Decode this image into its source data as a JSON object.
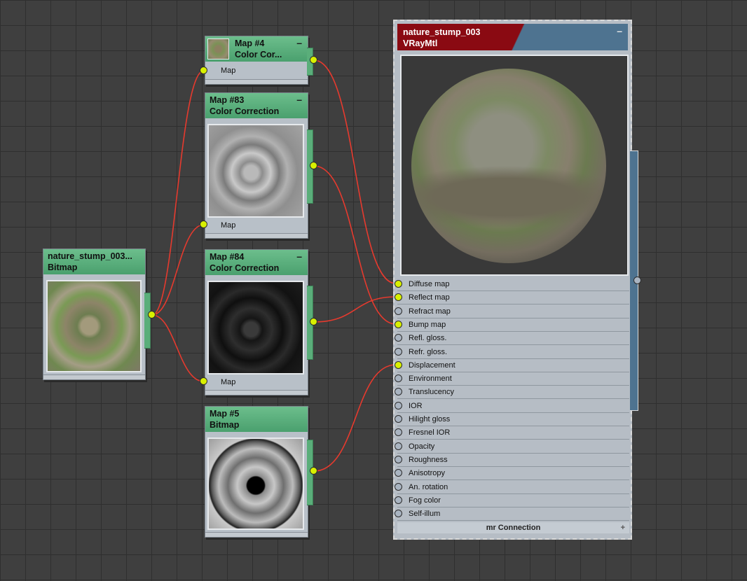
{
  "nodes": {
    "bitmap_src": {
      "title": "nature_stump_003...",
      "subtitle": "Bitmap"
    },
    "map4": {
      "title": "Map #4",
      "subtitle": "Color Cor...",
      "slot": "Map"
    },
    "map83": {
      "title": "Map #83",
      "subtitle": "Color Correction",
      "slot": "Map"
    },
    "map84": {
      "title": "Map #84",
      "subtitle": "Color Correction",
      "slot": "Map"
    },
    "map5": {
      "title": "Map #5",
      "subtitle": "Bitmap"
    }
  },
  "material": {
    "name": "nature_stump_003",
    "type": "VRayMtl",
    "slots": [
      {
        "label": "Diffuse map",
        "connected": true
      },
      {
        "label": "Reflect map",
        "connected": true
      },
      {
        "label": "Refract map",
        "connected": false
      },
      {
        "label": "Bump map",
        "connected": true
      },
      {
        "label": "Refl. gloss.",
        "connected": false
      },
      {
        "label": "Refr. gloss.",
        "connected": false
      },
      {
        "label": "Displacement",
        "connected": true
      },
      {
        "label": "Environment",
        "connected": false
      },
      {
        "label": "Translucency",
        "connected": false
      },
      {
        "label": "IOR",
        "connected": false
      },
      {
        "label": "Hilight gloss",
        "connected": false
      },
      {
        "label": "Fresnel IOR",
        "connected": false
      },
      {
        "label": "Opacity",
        "connected": false
      },
      {
        "label": "Roughness",
        "connected": false
      },
      {
        "label": "Anisotropy",
        "connected": false
      },
      {
        "label": "An. rotation",
        "connected": false
      },
      {
        "label": "Fog color",
        "connected": false
      },
      {
        "label": "Self-illum",
        "connected": false
      }
    ],
    "footer": "mr Connection",
    "minimize_glyph": "–",
    "expand_glyph": "+"
  },
  "icons": {
    "minimize": "minimize-icon",
    "socket_connected_color": "#d8f000",
    "socket_empty_color": "#a9b4c1",
    "wire_color": "#e63a2e",
    "node_header_color": "#5aae7a",
    "material_header_color": "#8a0a12"
  }
}
